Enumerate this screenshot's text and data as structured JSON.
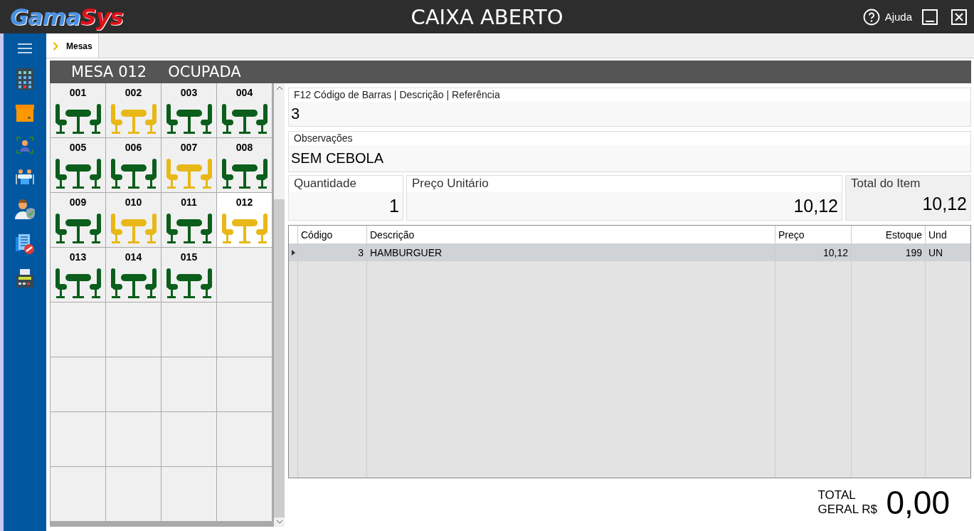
{
  "window": {
    "logo_left": "Gama",
    "logo_right": "Sys",
    "title": "CAIXA ABERTO",
    "help": "Ajuda"
  },
  "tabs": [
    {
      "label": "Mesas",
      "selected": true
    }
  ],
  "header": {
    "table": "MESA 012",
    "status": "OCUPADA"
  },
  "tables": [
    {
      "number": "001",
      "occupied": false,
      "selected": false
    },
    {
      "number": "002",
      "occupied": true,
      "selected": false
    },
    {
      "number": "003",
      "occupied": false,
      "selected": false
    },
    {
      "number": "004",
      "occupied": false,
      "selected": false
    },
    {
      "number": "005",
      "occupied": false,
      "selected": false
    },
    {
      "number": "006",
      "occupied": false,
      "selected": false
    },
    {
      "number": "007",
      "occupied": true,
      "selected": false
    },
    {
      "number": "008",
      "occupied": false,
      "selected": false
    },
    {
      "number": "009",
      "occupied": false,
      "selected": false
    },
    {
      "number": "010",
      "occupied": true,
      "selected": false
    },
    {
      "number": "011",
      "occupied": false,
      "selected": false
    },
    {
      "number": "012",
      "occupied": true,
      "selected": true
    },
    {
      "number": "013",
      "occupied": false,
      "selected": false
    },
    {
      "number": "014",
      "occupied": false,
      "selected": false
    },
    {
      "number": "015",
      "occupied": false,
      "selected": false
    }
  ],
  "search": {
    "label": "F12 Código de Barras | Descrição | Referência",
    "value": "3"
  },
  "notes": {
    "label": "Observações",
    "value": "SEM CEBOLA"
  },
  "quantity": {
    "label": "Quantidade",
    "value": "1"
  },
  "unit_price": {
    "label": "Preço Unitário",
    "value": "10,12"
  },
  "item_total": {
    "label": "Total do Item",
    "value": "10,12"
  },
  "grid": {
    "columns": [
      "Código",
      "Descrição",
      "Preço",
      "Estoque",
      "Und"
    ],
    "rows": [
      {
        "cells": [
          "3",
          "HAMBURGUER",
          "10,12",
          "199",
          "UN"
        ],
        "selected": true
      }
    ]
  },
  "total": {
    "label": "TOTAL GERAL R$",
    "value": "0,00"
  }
}
